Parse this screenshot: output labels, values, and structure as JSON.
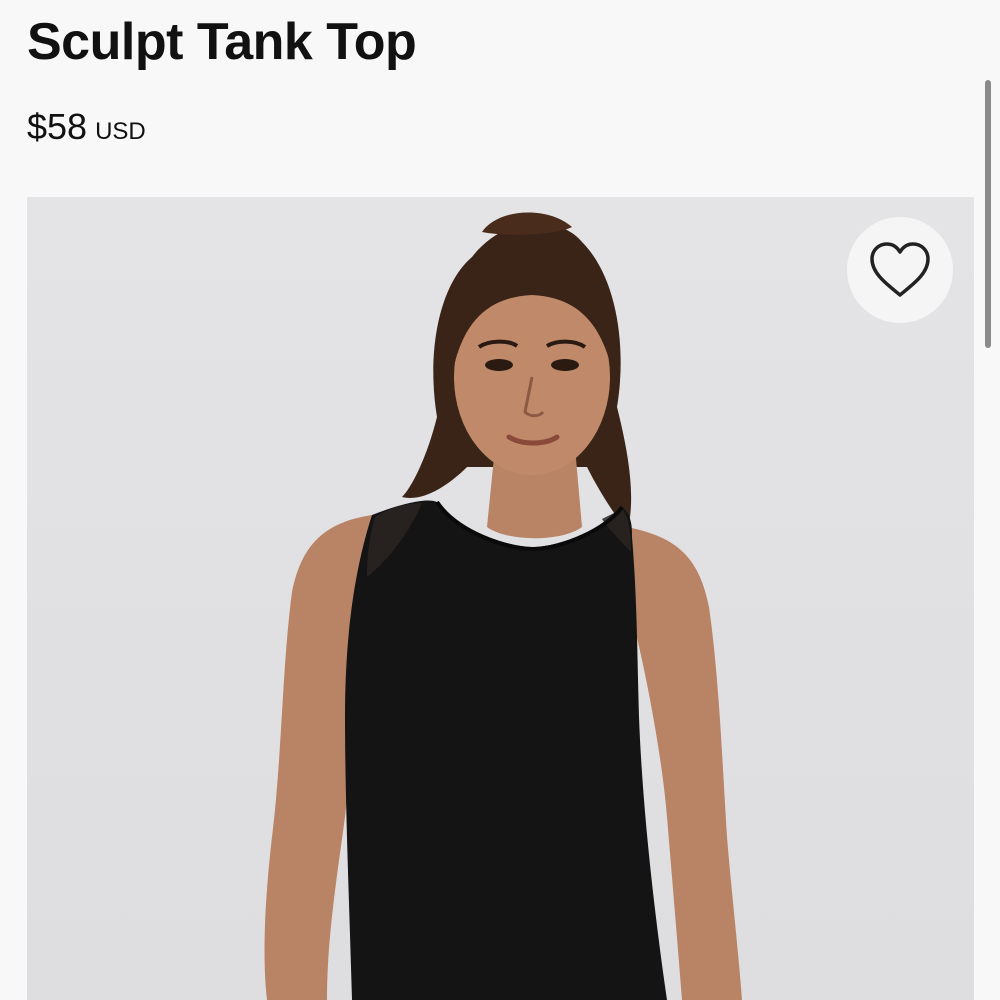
{
  "product": {
    "title": "Sculpt Tank Top",
    "price": "$58",
    "currency": "USD",
    "image_subject": "product-photo"
  },
  "wishlist": {
    "icon": "heart-icon"
  },
  "colors": {
    "text": "#111111",
    "background": "#f8f8f8",
    "image_background": "#e2e2e4",
    "garment": "#141414"
  }
}
